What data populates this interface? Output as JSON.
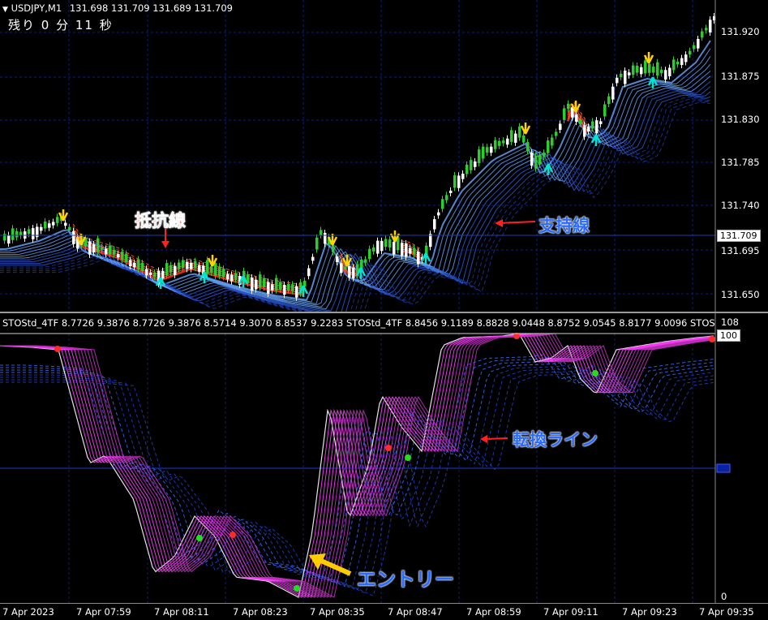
{
  "main_chart": {
    "header": {
      "symbol_timeframe": "USDJPY,M1",
      "ohlc": "131.698 131.709 131.689 131.709"
    },
    "remaining": "残り  0 分 11 秒",
    "price_axis": [
      "131.920",
      "131.875",
      "131.830",
      "131.785",
      "131.740",
      "131.695",
      "131.650"
    ],
    "current_price": "131.709",
    "annotations": {
      "resistance": "抵抗線",
      "support": "支持線"
    },
    "colors": {
      "bull": "#2ECC2E",
      "bear": "#FFFFFF",
      "resistance": "#FF2A1A",
      "support": "#3B7BFF",
      "arrow_up": "#00E5D0",
      "arrow_down": "#FFD400"
    }
  },
  "indicator": {
    "header": "STOStd_4TF 8.7726 9.3876 8.7726 9.3876 8.5714 9.3070 8.8537 9.2283   STOStd_4TF 8.8456 9.1189 8.8828 9.0448 8.8752 9.0545 8.8177 9.0096   STOS",
    "axis_top": "108",
    "axis_100": "100",
    "axis_0": "0",
    "annotations": {
      "turning_line": "転換ライン",
      "entry": "エントリー"
    }
  },
  "time_axis": [
    "7 Apr 2023",
    "7 Apr 07:59",
    "7 Apr 08:11",
    "7 Apr 08:23",
    "7 Apr 08:35",
    "7 Apr 08:47",
    "7 Apr 08:59",
    "7 Apr 09:11",
    "7 Apr 09:23",
    "7 Apr 09:35"
  ]
}
